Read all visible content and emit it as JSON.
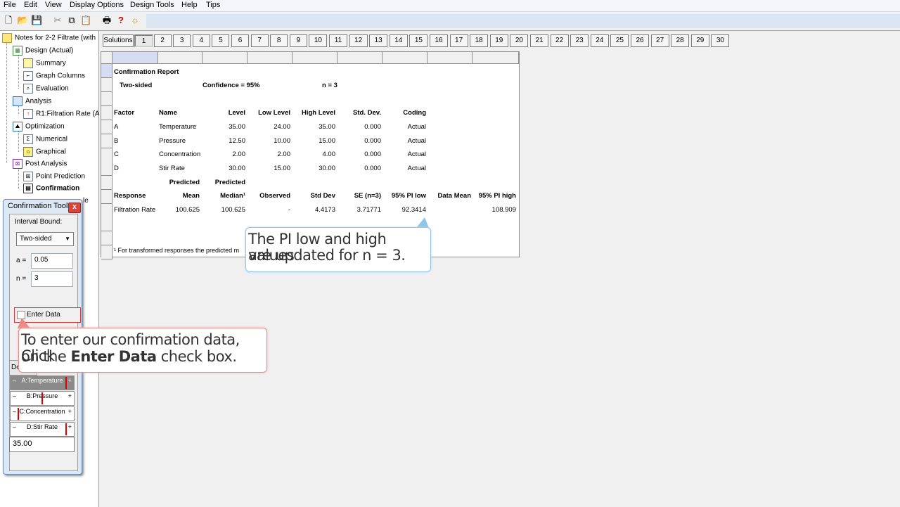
{
  "menu": [
    "File",
    "Edit",
    "View",
    "Display Options",
    "Design Tools",
    "Help",
    "Tips"
  ],
  "tree": {
    "root": "Notes for 2-2 Filtrate (with",
    "items": [
      {
        "label": "Design (Actual)",
        "level": 1,
        "icon": "grid-icon"
      },
      {
        "label": "Summary",
        "level": 2,
        "icon": "summary-icon"
      },
      {
        "label": "Graph Columns",
        "level": 2,
        "icon": "graph-columns-icon"
      },
      {
        "label": "Evaluation",
        "level": 2,
        "icon": "evaluation-icon"
      },
      {
        "label": "Analysis",
        "level": 1,
        "icon": "analysis-icon"
      },
      {
        "label": "R1:Filtration Rate (A",
        "level": 2,
        "icon": "response-icon"
      },
      {
        "label": "Optimization",
        "level": 1,
        "icon": "optimization-icon"
      },
      {
        "label": "Numerical",
        "level": 2,
        "icon": "numerical-icon"
      },
      {
        "label": "Graphical",
        "level": 2,
        "icon": "graphical-icon"
      },
      {
        "label": "Post Analysis",
        "level": 1,
        "icon": "post-analysis-icon"
      },
      {
        "label": "Point Prediction",
        "level": 2,
        "icon": "point-prediction-icon"
      },
      {
        "label": "Confirmation",
        "level": 2,
        "icon": "confirmation-icon",
        "selected": true
      }
    ],
    "partial_hidden": "le"
  },
  "solutions": {
    "label": "Solutions",
    "tabs": [
      "1",
      "2",
      "3",
      "4",
      "5",
      "6",
      "7",
      "8",
      "9",
      "10",
      "11",
      "12",
      "13",
      "14",
      "15",
      "16",
      "17",
      "18",
      "19",
      "20",
      "21",
      "22",
      "23",
      "24",
      "25",
      "26",
      "27",
      "28",
      "29",
      "30"
    ],
    "active": "1"
  },
  "report": {
    "title": "Confirmation Report",
    "sided": "Two-sided",
    "confidence": "Confidence = 95%",
    "n": "n =  3",
    "factor_headers": [
      "Factor",
      "Name",
      "Level",
      "Low Level",
      "High Level",
      "Std. Dev.",
      "Coding"
    ],
    "factors": [
      [
        "A",
        "Temperature",
        "35.00",
        "24.00",
        "35.00",
        "0.000",
        "Actual"
      ],
      [
        "B",
        "Pressure",
        "12.50",
        "10.00",
        "15.00",
        "0.000",
        "Actual"
      ],
      [
        "C",
        "Concentration",
        "2.00",
        "2.00",
        "4.00",
        "0.000",
        "Actual"
      ],
      [
        "D",
        "Stir Rate",
        "30.00",
        "15.00",
        "30.00",
        "0.000",
        "Actual"
      ]
    ],
    "predicted_top": [
      "Predicted",
      "Predicted"
    ],
    "response_headers": [
      "Response",
      "Mean",
      "Median¹",
      "Observed",
      "Std Dev",
      "SE (n=3)",
      "95% PI low",
      "Data Mean",
      "95% PI high"
    ],
    "response_row": [
      "Filtration Rate",
      "100.625",
      "100.625",
      "-",
      "4.4173",
      "3.71771",
      "92.3414",
      "",
      "108.909"
    ],
    "footnote": "¹ For transformed responses the predicted m"
  },
  "tool": {
    "title": "Confirmation Tool",
    "interval_label": "Interval Bound:",
    "interval_value": "Two-sided",
    "alpha_label": "a =",
    "alpha_value": "0.05",
    "n_label": "n =",
    "n_value": "3",
    "enter_data_label": "Enter Data",
    "partial_buttons": [
      "De"
    ],
    "sliders": [
      {
        "label": "A:Temperature",
        "minus": "–",
        "plus": "+"
      },
      {
        "label": "B:Pressure",
        "minus": "–",
        "plus": "+"
      },
      {
        "label": "C:Concentration",
        "minus": "–",
        "plus": "+"
      },
      {
        "label": "D:Stir Rate",
        "minus": "–",
        "plus": "+"
      }
    ],
    "value_box": "35.00"
  },
  "callouts": {
    "pi_line1": "The PI low and high values",
    "pi_line2": "are updated for n = 3.",
    "enter_line1": "To enter our confirmation data, Click",
    "enter_line2_pre": "on the ",
    "enter_line2_bold": "Enter Data",
    "enter_line2_post": "  check box."
  },
  "colors": {
    "accent_blue": "#8ec5ea",
    "accent_red": "#e88a86",
    "slider_marker": "#e00000"
  }
}
